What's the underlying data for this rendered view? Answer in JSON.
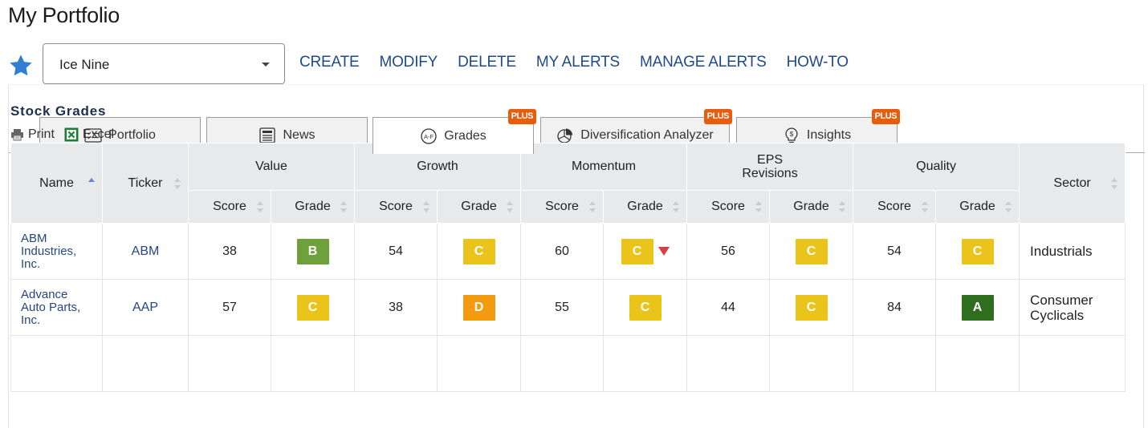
{
  "page": {
    "title": "My Portfolio"
  },
  "toolbar": {
    "portfolio_select": {
      "value": "Ice Nine"
    },
    "links": [
      "CREATE",
      "MODIFY",
      "DELETE",
      "MY ALERTS",
      "MANAGE ALERTS",
      "HOW-TO"
    ]
  },
  "tabs": [
    {
      "label": "Portfolio",
      "icon": "checklist-icon",
      "active": false,
      "plus": false
    },
    {
      "label": "News",
      "icon": "newspaper-icon",
      "active": false,
      "plus": false
    },
    {
      "label": "Grades",
      "icon": "grades-af-icon",
      "active": true,
      "plus": true
    },
    {
      "label": "Diversification Analyzer",
      "icon": "pie-chart-icon",
      "active": false,
      "plus": true
    },
    {
      "label": "Insights",
      "icon": "lightbulb-dollar-icon",
      "active": false,
      "plus": true
    }
  ],
  "plus_label": "PLUS",
  "section": {
    "title": "Stock Grades",
    "print": "Print",
    "excel": "Excel"
  },
  "table": {
    "headers": {
      "name": "Name",
      "ticker": "Ticker",
      "groups": [
        "Value",
        "Growth",
        "Momentum",
        "EPS Revisions",
        "Quality"
      ],
      "score": "Score",
      "grade": "Grade",
      "sector": "Sector"
    },
    "rows": [
      {
        "name": "ABM Industries, Inc.",
        "ticker": "ABM",
        "cells": [
          {
            "score": "38",
            "grade": "B"
          },
          {
            "score": "54",
            "grade": "C"
          },
          {
            "score": "60",
            "grade": "C",
            "down": true
          },
          {
            "score": "56",
            "grade": "C"
          },
          {
            "score": "54",
            "grade": "C"
          }
        ],
        "sector": "Industrials"
      },
      {
        "name": "Advance Auto Parts, Inc.",
        "ticker": "AAP",
        "cells": [
          {
            "score": "57",
            "grade": "C"
          },
          {
            "score": "38",
            "grade": "D"
          },
          {
            "score": "55",
            "grade": "C"
          },
          {
            "score": "44",
            "grade": "C"
          },
          {
            "score": "84",
            "grade": "A"
          }
        ],
        "sector": "Consumer Cyclicals"
      }
    ]
  },
  "colors": {
    "link": "#1e4a8c",
    "plus": "#e85d0c",
    "star": "#2f7fd4",
    "grade_A": "#2f6e1e",
    "grade_B": "#6ea13c",
    "grade_C": "#ebc41b",
    "grade_D": "#f39a0f"
  }
}
